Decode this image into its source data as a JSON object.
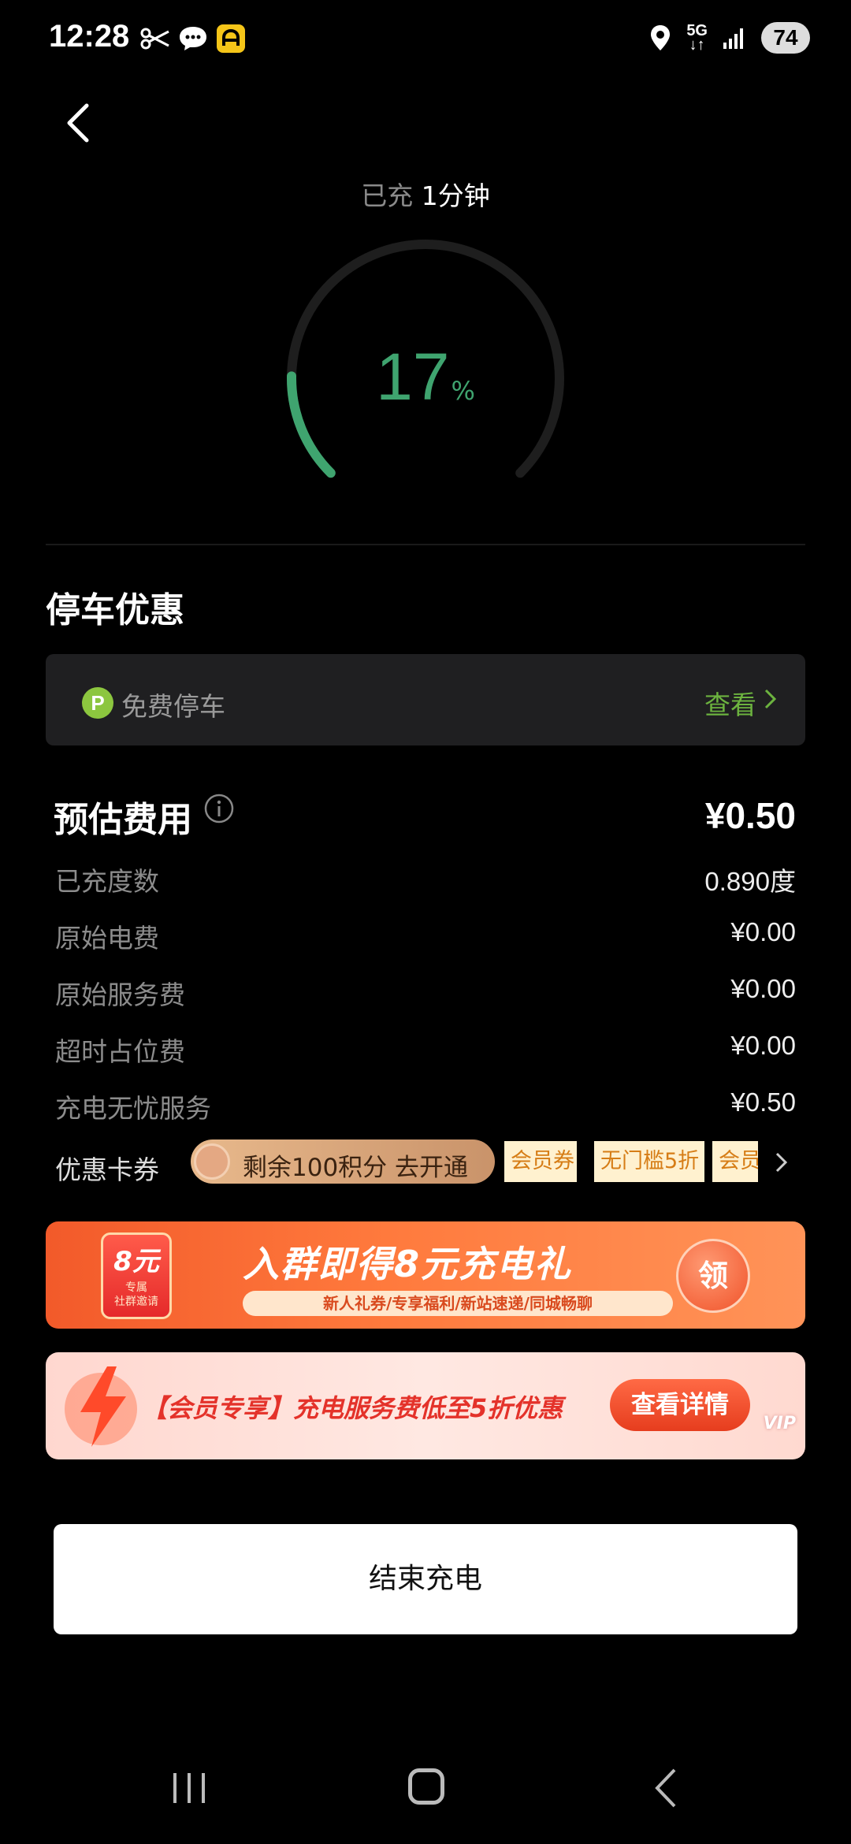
{
  "status_bar": {
    "time": "12:28",
    "network": "5G",
    "battery": "74",
    "icons": [
      "scissors-icon",
      "chat-icon",
      "app-icon",
      "location-icon",
      "signal-icon"
    ]
  },
  "charging": {
    "charged_prefix": "已充",
    "charged_duration": "1分钟",
    "percent": "17",
    "percent_unit": "%",
    "progress_fraction": 0.17,
    "accent_color": "#3fa46f"
  },
  "parking": {
    "title": "停车优惠",
    "icon_letter": "P",
    "label": "免费停车",
    "view_label": "查看"
  },
  "fees": {
    "title": "预估费用",
    "total": "¥0.50",
    "rows": [
      {
        "label": "已充度数",
        "value": "0.890度"
      },
      {
        "label": "原始电费",
        "value": "¥0.00"
      },
      {
        "label": "原始服务费",
        "value": "¥0.00"
      },
      {
        "label": "超时占位费",
        "value": "¥0.00"
      },
      {
        "label": "充电无忧服务",
        "value": "¥0.50"
      }
    ]
  },
  "coupons": {
    "label": "优惠卡券",
    "points_text": "剩余100积分 去开通",
    "chips": [
      "会员券",
      "无门槛5折",
      "会员"
    ]
  },
  "banner1": {
    "envelope_num": "8元",
    "envelope_sub1": "专属",
    "envelope_sub2": "社群邀请",
    "title": "入群即得8元充电礼",
    "subtitle": "新人礼券/专享福利/新站速递/同城畅聊",
    "claim": "领"
  },
  "banner2": {
    "title": "【会员专享】充电服务费低至5折优惠",
    "button": "查看详情",
    "badge": "VIP"
  },
  "end_button": "结束充电"
}
